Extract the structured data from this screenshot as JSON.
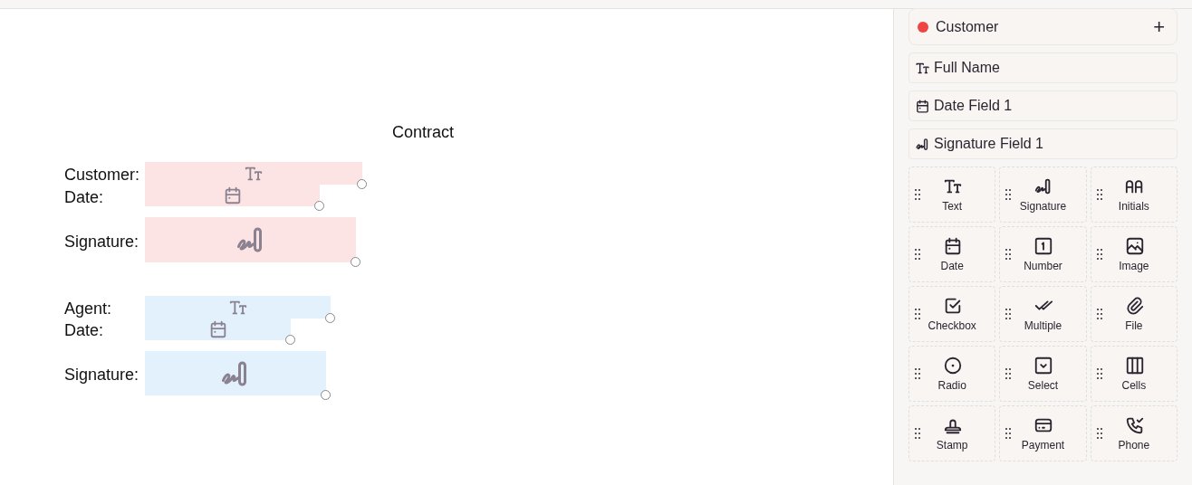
{
  "document": {
    "title": "Contract",
    "labels": [
      {
        "text": "Customer:"
      },
      {
        "text": "Date:"
      },
      {
        "text": "Signature:"
      },
      {
        "text": "Agent:"
      },
      {
        "text": "Date:"
      },
      {
        "text": "Signature:"
      }
    ],
    "fields": [
      {
        "kind": "text",
        "color": "#fde4e4"
      },
      {
        "kind": "date",
        "color": "#fde4e4"
      },
      {
        "kind": "signature",
        "color": "#fde4e4"
      },
      {
        "kind": "text",
        "color": "#e2f1fc"
      },
      {
        "kind": "date",
        "color": "#e2f1fc"
      },
      {
        "kind": "signature",
        "color": "#e2f1fc"
      }
    ]
  },
  "sidebar": {
    "party": {
      "name": "Customer",
      "color": "#ef4444",
      "add_button": "+"
    },
    "fields": [
      {
        "kind": "text",
        "label": "Full Name"
      },
      {
        "kind": "date",
        "label": "Date Field 1"
      },
      {
        "kind": "signature",
        "label": "Signature Field 1"
      }
    ],
    "palette": [
      {
        "kind": "text",
        "label": "Text"
      },
      {
        "kind": "signature",
        "label": "Signature"
      },
      {
        "kind": "initials",
        "label": "Initials"
      },
      {
        "kind": "date",
        "label": "Date"
      },
      {
        "kind": "number",
        "label": "Number"
      },
      {
        "kind": "image",
        "label": "Image"
      },
      {
        "kind": "checkbox",
        "label": "Checkbox"
      },
      {
        "kind": "multiple",
        "label": "Multiple"
      },
      {
        "kind": "file",
        "label": "File"
      },
      {
        "kind": "radio",
        "label": "Radio"
      },
      {
        "kind": "select",
        "label": "Select"
      },
      {
        "kind": "cells",
        "label": "Cells"
      },
      {
        "kind": "stamp",
        "label": "Stamp"
      },
      {
        "kind": "payment",
        "label": "Payment"
      },
      {
        "kind": "phone",
        "label": "Phone"
      }
    ]
  }
}
